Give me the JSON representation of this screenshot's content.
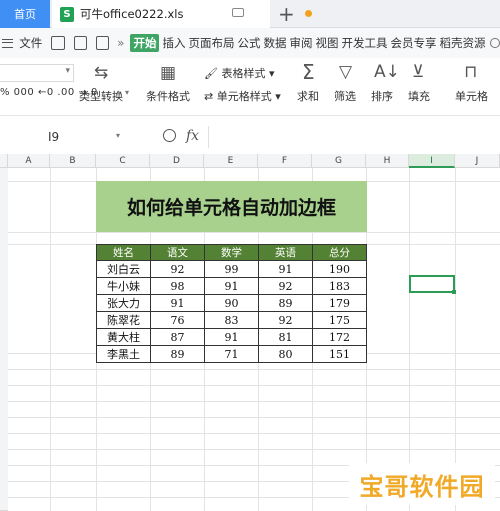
{
  "tabs": {
    "home_label": "首页",
    "file_label": "可牛office0222.xls",
    "file_icon": "S"
  },
  "menu": {
    "file": "文件",
    "start": "开始",
    "items": [
      "插入",
      "页面布局",
      "公式",
      "数据",
      "审阅",
      "视图",
      "开发工具",
      "会员专享",
      "稻壳资源"
    ]
  },
  "ribbon": {
    "number_format": "%  000  ←0 .00  →.0",
    "type_convert": "类型转换",
    "conditional_format": "条件格式",
    "table_style": "表格样式",
    "cell_style": "单元格样式",
    "sum": "求和",
    "filter": "筛选",
    "sort": "排序",
    "fill": "填充",
    "cell": "单元格"
  },
  "formula_bar": {
    "name_box": "I9",
    "fx": "fx",
    "value": ""
  },
  "sheet": {
    "columns": [
      "A",
      "B",
      "C",
      "D",
      "E",
      "F",
      "G",
      "H",
      "I",
      "J"
    ],
    "selected_column": "I",
    "active_cell": "I9"
  },
  "table": {
    "title": "如何给单元格自动加边框",
    "headers": [
      "姓名",
      "语文",
      "数学",
      "英语",
      "总分"
    ],
    "rows": [
      [
        "刘白云",
        "92",
        "99",
        "91",
        "190"
      ],
      [
        "牛小妹",
        "98",
        "91",
        "92",
        "183"
      ],
      [
        "张大力",
        "91",
        "90",
        "89",
        "179"
      ],
      [
        "陈翠花",
        "76",
        "83",
        "92",
        "175"
      ],
      [
        "黄大柱",
        "87",
        "91",
        "81",
        "172"
      ],
      [
        "李黑土",
        "89",
        "71",
        "80",
        "151"
      ]
    ]
  },
  "watermark": "宝哥软件园",
  "colors": {
    "accent": "#3f8ff5",
    "green": "#2e9b57",
    "title_fill": "#a9d18e",
    "header_fill": "#548235"
  }
}
